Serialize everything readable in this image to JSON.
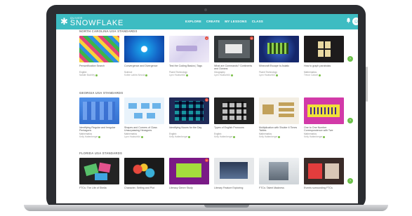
{
  "app": {
    "logo_small": "QUIVER",
    "logo_main": "SNOWFLAKE",
    "nav": [
      "EXPLORE",
      "CREATE",
      "MY LESSONS",
      "CLASS"
    ]
  },
  "sections": [
    {
      "title": "NORTH CAROLINA USA STANDARDS",
      "cards": [
        {
          "title": "Personification Search",
          "subject": "English",
          "author": "Natalie Bachley"
        },
        {
          "title": "Convergence and Divergence",
          "subject": "Science",
          "author": "Kolbie Labbe-Neccia"
        },
        {
          "title": "Test the Coding Basics | Tags",
          "subject": "Fluent Technology",
          "author": "Lynn Hautschild"
        },
        {
          "title": "What are Commands? Continents and Oceans",
          "subject": "Geography",
          "author": "Lynn Hautschild"
        },
        {
          "title": "Minecraft Escape to Asiatic",
          "subject": "Fluent Technology",
          "author": "Lynn Hautschild"
        },
        {
          "title": "How to graph parabolas",
          "subject": "Mathematics",
          "author": "Trevor Calcott"
        }
      ]
    },
    {
      "title": "GEORGIA USA STANDARDS",
      "cards": [
        {
          "title": "Identifying Regular and Irregular Pentagons",
          "subject": "Mathematics",
          "author": "Kelly Hattenberger"
        },
        {
          "title": "Shapes and Corners of Class Unsurpassing Hexagons",
          "subject": "Mathematics",
          "author": "Lynn Hautschild"
        },
        {
          "title": "Identifying Nouns for the Day",
          "subject": "English",
          "author": "Kelly Hattenberger"
        },
        {
          "title": "Types of English Pronouns",
          "subject": "English",
          "author": "Kelly Hattenberger"
        },
        {
          "title": "Multiplication with Shutter it Times Tables",
          "subject": "Mathematics",
          "author": "Kelly Hattenberger"
        },
        {
          "title": "One to One Number Correspondence with Twe",
          "subject": "Mathematics",
          "author": "Kelly Hattenberger"
        }
      ]
    },
    {
      "title": "FLORIDA USA STANDARDS",
      "cards": [
        {
          "title": "FTCs: The Life of Sheila",
          "subject": "",
          "author": ""
        },
        {
          "title": "Character, Setting and Plot",
          "subject": "",
          "author": ""
        },
        {
          "title": "Literacy Genre Study",
          "subject": "",
          "author": ""
        },
        {
          "title": "Literary Feature Exploring",
          "subject": "",
          "author": ""
        },
        {
          "title": "FTCs: Talent Madness",
          "subject": "",
          "author": ""
        },
        {
          "title": "Events surrounding FTCs",
          "subject": "",
          "author": ""
        }
      ]
    }
  ],
  "colors": {
    "topbar": "#3dbcc2",
    "accent_green": "#6cc04a",
    "badge_red": "#e74c3c"
  },
  "icons": [
    "snowflake-icon",
    "bell-icon",
    "avatar-icon",
    "chevron-right-icon",
    "remove-icon"
  ]
}
